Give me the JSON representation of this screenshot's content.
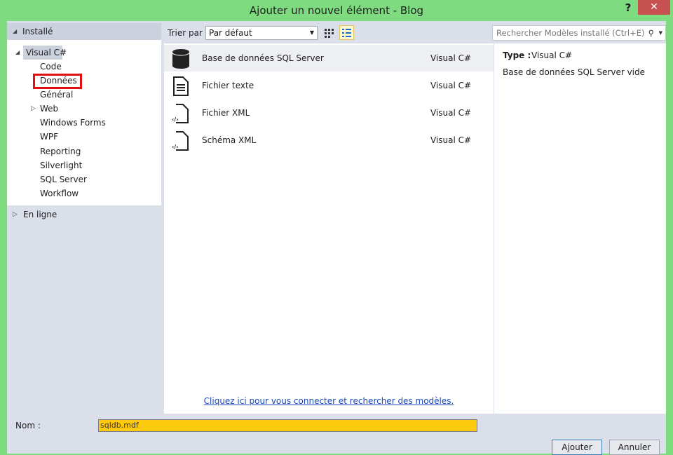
{
  "window": {
    "title": "Ajouter un nouvel élément - Blog",
    "help": "?",
    "close": "✕"
  },
  "left": {
    "header": "Installé",
    "root": "Visual C#",
    "items": [
      "Code",
      "Données",
      "Général",
      "Web",
      "Windows Forms",
      "WPF",
      "Reporting",
      "Silverlight",
      "SQL Server",
      "Workflow"
    ],
    "online": "En ligne",
    "highlighted": "Données"
  },
  "toolbar": {
    "sort_label": "Trier par :",
    "sort_value": "Par défaut"
  },
  "search": {
    "placeholder": "Rechercher Modèles installé (Ctrl+E)"
  },
  "templates": [
    {
      "name": "Base de données SQL Server",
      "type": "Visual C#",
      "icon": "database-icon"
    },
    {
      "name": "Fichier texte",
      "type": "Visual C#",
      "icon": "text-file-icon"
    },
    {
      "name": "Fichier XML",
      "type": "Visual C#",
      "icon": "xml-file-icon"
    },
    {
      "name": "Schéma XML",
      "type": "Visual C#",
      "icon": "xml-schema-icon"
    }
  ],
  "details": {
    "type_label": "Type :",
    "type_value": "Visual C#",
    "description": "Base de données SQL Server vide"
  },
  "link": "Cliquez ici pour vous connecter et rechercher des modèles.",
  "name_field": {
    "label": "Nom :",
    "value": "sqldb.mdf"
  },
  "buttons": {
    "add": "Ajouter",
    "cancel": "Annuler"
  },
  "colors": {
    "frame": "#7fdb7f",
    "close": "#c75050",
    "highlight_box": "#e01010",
    "name_field": "#ffc90e"
  }
}
